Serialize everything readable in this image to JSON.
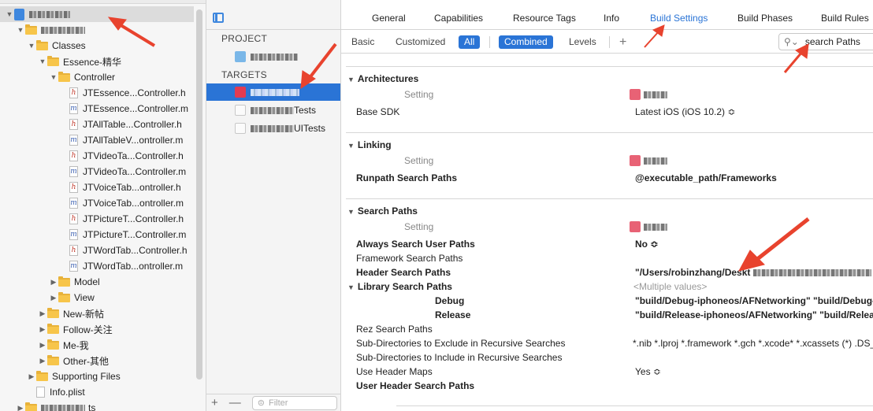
{
  "navigator": {
    "items": [
      {
        "label": "",
        "kind": "project",
        "level": 0,
        "disclosure": "▼",
        "redacted": true,
        "selected": true
      },
      {
        "label": "",
        "kind": "folder",
        "level": 1,
        "disclosure": "▼",
        "redacted": true
      },
      {
        "label": "Classes",
        "kind": "folder",
        "level": 2,
        "disclosure": "▼"
      },
      {
        "label": "Essence-精华",
        "kind": "folder",
        "level": 3,
        "disclosure": "▼"
      },
      {
        "label": "Controller",
        "kind": "folder",
        "level": 4,
        "disclosure": "▼"
      },
      {
        "label": "JTEssence...Controller.h",
        "kind": "h",
        "level": 5
      },
      {
        "label": "JTEssence...Controller.m",
        "kind": "m",
        "level": 5
      },
      {
        "label": "JTAllTable...Controller.h",
        "kind": "h",
        "level": 5
      },
      {
        "label": "JTAllTableV...ontroller.m",
        "kind": "m",
        "level": 5
      },
      {
        "label": "JTVideoTa...Controller.h",
        "kind": "h",
        "level": 5
      },
      {
        "label": "JTVideoTa...Controller.m",
        "kind": "m",
        "level": 5
      },
      {
        "label": "JTVoiceTab...ontroller.h",
        "kind": "h",
        "level": 5
      },
      {
        "label": "JTVoiceTab...ontroller.m",
        "kind": "m",
        "level": 5
      },
      {
        "label": "JTPictureT...Controller.h",
        "kind": "h",
        "level": 5
      },
      {
        "label": "JTPictureT...Controller.m",
        "kind": "m",
        "level": 5
      },
      {
        "label": "JTWordTab...Controller.h",
        "kind": "h",
        "level": 5
      },
      {
        "label": "JTWordTab...ontroller.m",
        "kind": "m",
        "level": 5
      },
      {
        "label": "Model",
        "kind": "folder",
        "level": 4,
        "disclosure": "▶"
      },
      {
        "label": "View",
        "kind": "folder",
        "level": 4,
        "disclosure": "▶"
      },
      {
        "label": "New-新帖",
        "kind": "folder",
        "level": 3,
        "disclosure": "▶"
      },
      {
        "label": "Follow-关注",
        "kind": "folder",
        "level": 3,
        "disclosure": "▶"
      },
      {
        "label": "Me-我",
        "kind": "folder",
        "level": 3,
        "disclosure": "▶"
      },
      {
        "label": "Other-其他",
        "kind": "folder",
        "level": 3,
        "disclosure": "▶"
      },
      {
        "label": "Supporting Files",
        "kind": "folder",
        "level": 2,
        "disclosure": "▶"
      },
      {
        "label": "Info.plist",
        "kind": "plist",
        "level": 2
      },
      {
        "label": "ts",
        "kind": "folder",
        "level": 1,
        "disclosure": "▶",
        "redacted": true
      }
    ]
  },
  "targets_panel": {
    "project_heading": "PROJECT",
    "targets_heading": "TARGETS",
    "tests_suffix": "Tests",
    "uitests_suffix": "UITests",
    "filter_placeholder": "Filter",
    "add_label": "+",
    "remove_label": "—"
  },
  "editor_tabs": [
    "General",
    "Capabilities",
    "Resource Tags",
    "Info",
    "Build Settings",
    "Build Phases",
    "Build Rules"
  ],
  "active_tab": "Build Settings",
  "filterbar": {
    "basic": "Basic",
    "customized": "Customized",
    "all": "All",
    "combined": "Combined",
    "levels": "Levels",
    "add": "+",
    "search_value": "search Paths"
  },
  "settings": {
    "setting_label": "Setting",
    "architectures": {
      "title": "Architectures",
      "base_sdk_name": "Base SDK",
      "base_sdk_value": "Latest iOS (iOS 10.2) ≎"
    },
    "linking": {
      "title": "Linking",
      "runpath_name": "Runpath Search Paths",
      "runpath_value": "@executable_path/Frameworks"
    },
    "search_paths": {
      "title": "Search Paths",
      "rows": [
        {
          "name": "Always Search User Paths",
          "value": "No ≎",
          "bold": true
        },
        {
          "name": "Framework Search Paths",
          "value": "",
          "bold": false
        },
        {
          "name": "Header Search Paths",
          "value": "\"/Users/robinzhang/Deskt",
          "bold": true
        },
        {
          "name": "Library Search Paths",
          "value": "<Multiple values>",
          "bold": true
        },
        {
          "name": "Debug",
          "value": "\"build/Debug-iphoneos/AFNetworking\" \"build/Debug-",
          "bold": true
        },
        {
          "name": "Release",
          "value": "\"build/Release-iphoneos/AFNetworking\" \"build/Releas",
          "bold": true
        },
        {
          "name": "Rez Search Paths",
          "value": "",
          "bold": false
        },
        {
          "name": "Sub-Directories to Exclude in Recursive Searches",
          "value": "*.nib *.lproj *.framework *.gch *.xcode* *.xcassets (*) .DS_S",
          "bold": false
        },
        {
          "name": "Sub-Directories to Include in Recursive Searches",
          "value": "",
          "bold": false
        },
        {
          "name": "Use Header Maps",
          "value": "Yes ≎",
          "bold": false
        },
        {
          "name": "User Header Search Paths",
          "value": "",
          "bold": true
        }
      ]
    }
  },
  "colors": {
    "accent": "#2a74d6",
    "annotation_arrow": "#e8432e",
    "folder": "#f7c54a"
  }
}
